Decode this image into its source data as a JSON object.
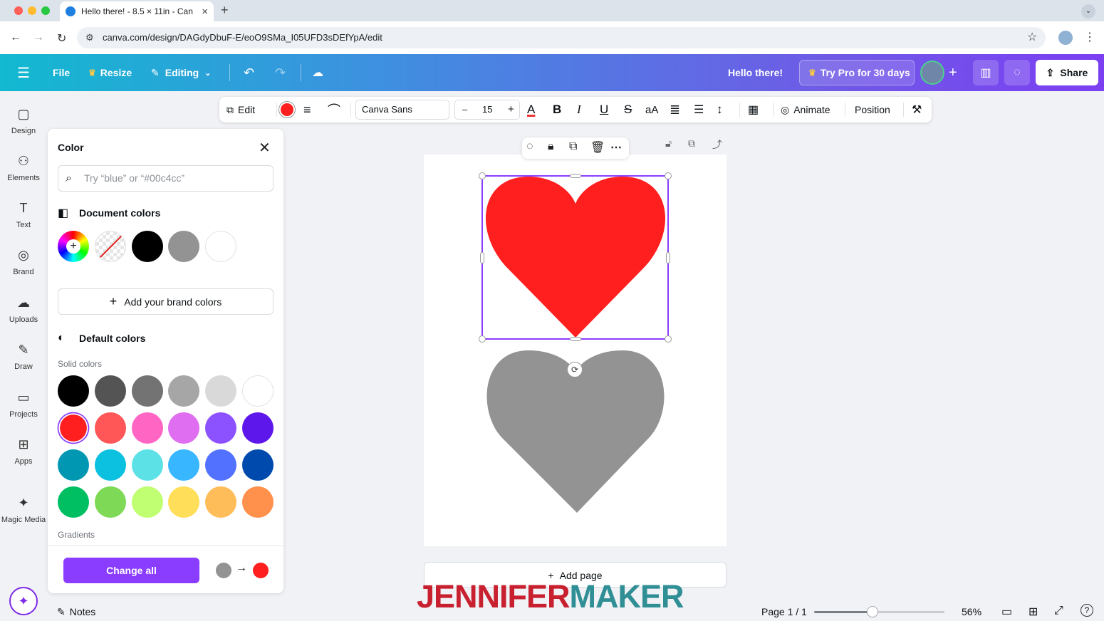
{
  "browser": {
    "tab_title": "Hello there! - 8.5 × 11in - Can",
    "url": "canva.com/design/DAGdyDbuF-E/eoO9SMa_I05UFD3sDEfYpA/edit"
  },
  "header": {
    "file": "File",
    "resize": "Resize",
    "editing": "Editing",
    "design_title": "Hello there!",
    "try_pro": "Try Pro for 30 days",
    "share": "Share"
  },
  "rail": [
    {
      "label": "Design",
      "icon": "▢"
    },
    {
      "label": "Elements",
      "icon": "⚇"
    },
    {
      "label": "Text",
      "icon": "T"
    },
    {
      "label": "Brand",
      "icon": "◎"
    },
    {
      "label": "Uploads",
      "icon": "☁"
    },
    {
      "label": "Draw",
      "icon": "✎"
    },
    {
      "label": "Projects",
      "icon": "▭"
    },
    {
      "label": "Apps",
      "icon": "⊞"
    },
    {
      "label": "Magic Media",
      "icon": "✦"
    }
  ],
  "color_panel": {
    "title": "Color",
    "search_placeholder": "Try “blue” or “#00c4cc”",
    "document_colors_title": "Document colors",
    "document_colors": [
      "#000000",
      "#939393",
      "#ffffff"
    ],
    "add_brand_colors": "Add your brand colors",
    "default_colors_title": "Default colors",
    "solid_colors_label": "Solid colors",
    "solid_colors": [
      [
        "#000000",
        "#545454",
        "#737373",
        "#a6a6a6",
        "#d9d9d9",
        "#ffffff"
      ],
      [
        "#ff1f1f",
        "#ff5757",
        "#ff66c4",
        "#e06ef0",
        "#8c52ff",
        "#5e17eb"
      ],
      [
        "#0097b2",
        "#0cc0df",
        "#5ce1e6",
        "#38b6ff",
        "#5271ff",
        "#004aad"
      ],
      [
        "#00bf63",
        "#7ed957",
        "#c1ff72",
        "#ffde59",
        "#ffbd59",
        "#ff914d"
      ]
    ],
    "selected_color": "#ff1f1f",
    "gradients_label": "Gradients",
    "change_all": "Change all",
    "change_from": "#939393",
    "change_to": "#ff1f1f"
  },
  "toolbar": {
    "edit": "Edit",
    "fill_color": "#ff1f1f",
    "font": "Canva Sans",
    "font_size": "15",
    "minus": "–",
    "plus": "+",
    "case": "aA",
    "animate": "Animate",
    "position": "Position"
  },
  "canvas": {
    "heart_top_color": "#ff1f1f",
    "heart_bottom_color": "#939393",
    "add_page": "Add page"
  },
  "watermark": {
    "part1": "JENNIFER",
    "part2": "MAKER",
    "color1": "#c8202f",
    "color2": "#2f8f95"
  },
  "status": {
    "notes": "Notes",
    "page": "Page 1 / 1",
    "zoom": "56%",
    "zoom_fraction": 0.45
  }
}
